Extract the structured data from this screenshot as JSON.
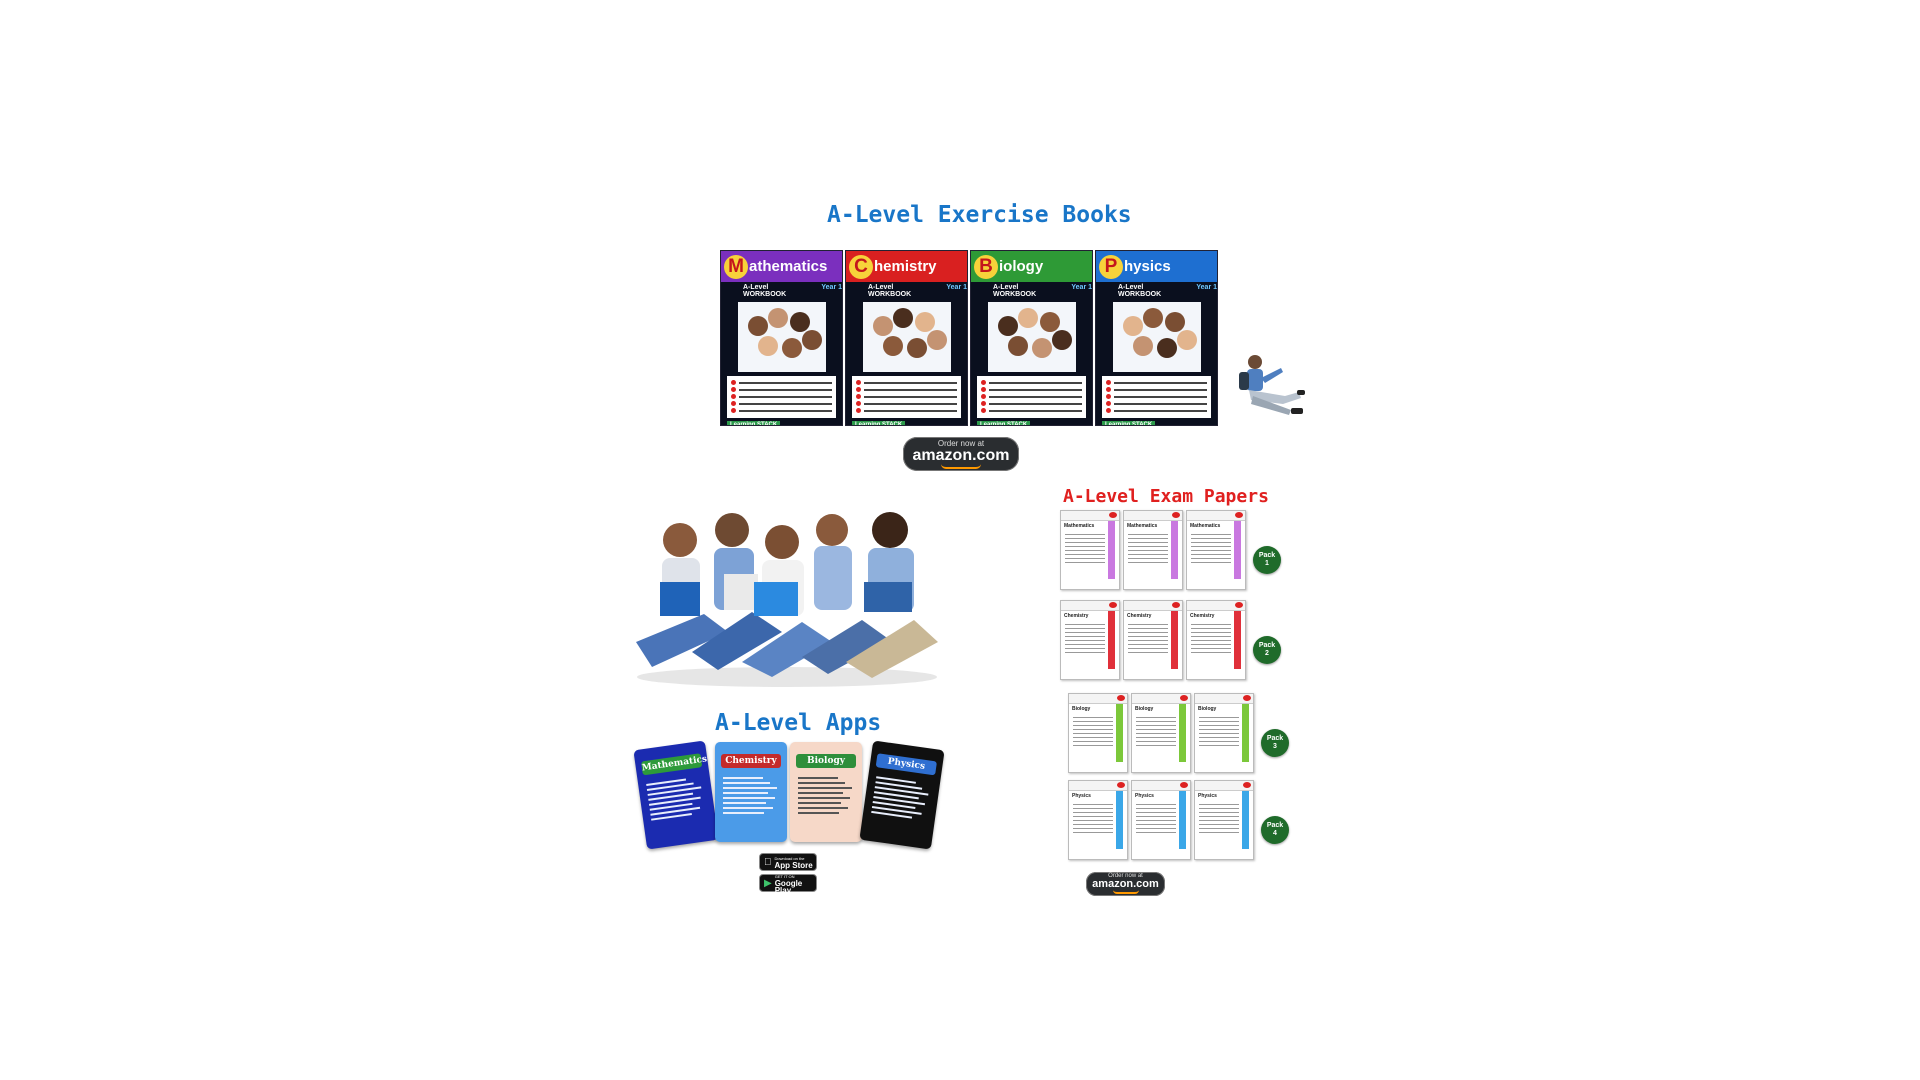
{
  "sections": {
    "books_title": "A-Level Exercise Books",
    "apps_title": "A-Level Apps",
    "exams_title": "A-Level Exam Papers"
  },
  "books": [
    {
      "letter": "M",
      "rest": "athematics",
      "color": "#7b2fbe",
      "sub": "A-Level WORKBOOK",
      "year": "Year 1"
    },
    {
      "letter": "C",
      "rest": "hemistry",
      "color": "#d92020",
      "sub": "A-Level WORKBOOK",
      "year": "Year 1"
    },
    {
      "letter": "B",
      "rest": "iology",
      "color": "#2e9a36",
      "sub": "A-Level WORKBOOK",
      "year": "Year 1"
    },
    {
      "letter": "P",
      "rest": "hysics",
      "color": "#1e6fd1",
      "sub": "A-Level WORKBOOK",
      "year": "Year 1"
    }
  ],
  "book_badge": "Learning STACK",
  "amazon": {
    "small": "Order now at",
    "big": "amazon.com"
  },
  "apps": [
    {
      "name": "Mathematics",
      "bg": "#1b2bb0",
      "title_bg": "#2d9a3a"
    },
    {
      "name": "Chemistry",
      "bg": "#4b9be8",
      "title_bg": "#c42a2a"
    },
    {
      "name": "Biology",
      "bg": "#f6d8c8",
      "title_bg": "#2e8f3b"
    },
    {
      "name": "Physics",
      "bg": "#101010",
      "title_bg": "#2f6fd1"
    }
  ],
  "stores": {
    "appstore_small": "Download on the",
    "appstore": "App Store",
    "google_small": "GET IT ON",
    "google": "Google Play"
  },
  "packs": [
    {
      "label": "Pack",
      "num": "1",
      "subject": "Mathematics",
      "color": "#c978e0"
    },
    {
      "label": "Pack",
      "num": "2",
      "subject": "Chemistry",
      "color": "#e0303a"
    },
    {
      "label": "Pack",
      "num": "3",
      "subject": "Biology",
      "color": "#7cc83a"
    },
    {
      "label": "Pack",
      "num": "4",
      "subject": "Physics",
      "color": "#3aa7e8"
    }
  ]
}
